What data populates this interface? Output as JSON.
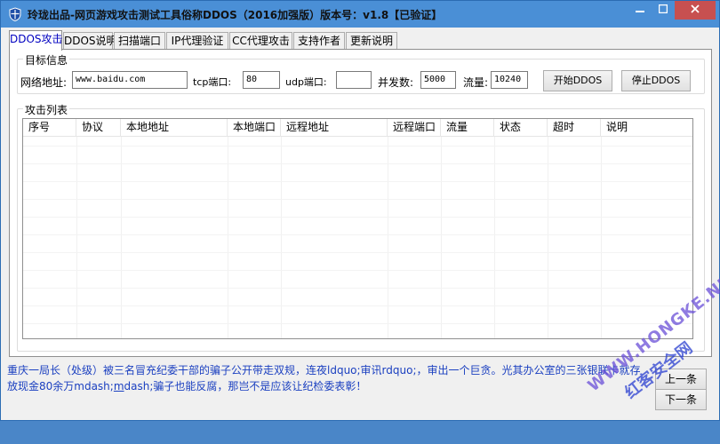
{
  "window": {
    "title": "玲珑出品-网页游戏攻击测试工具俗称DDOS（2016加强版）版本号：v1.8【已验证】",
    "accent": "#4a8fd6"
  },
  "tabs": [
    {
      "label": "DDOS攻击",
      "active": true
    },
    {
      "label": "DDOS说明"
    },
    {
      "label": "扫描端口"
    },
    {
      "label": "IP代理验证"
    },
    {
      "label": "CC代理攻击"
    },
    {
      "label": "支持作者"
    },
    {
      "label": "更新说明"
    }
  ],
  "target": {
    "group_label": "目标信息",
    "url_label": "网络地址:",
    "url_value": "www.baidu.com",
    "tcp_label": "tcp端口:",
    "tcp_value": "80",
    "udp_label": "udp端口:",
    "udp_value": "",
    "concurrency_label": "并发数:",
    "concurrency_value": "5000",
    "traffic_label": "流量:",
    "traffic_value": "10240",
    "start_button": "开始DDOS",
    "stop_button": "停止DDOS"
  },
  "attack_list": {
    "group_label": "攻击列表",
    "columns": [
      "序号",
      "协议",
      "本地地址",
      "本地端口",
      "远程地址",
      "远程端口",
      "流量",
      "状态",
      "超时",
      "说明"
    ]
  },
  "footer": {
    "line1": "重庆一局长（处级）被三名冒充纪委干部的骗子公开带走双规，连夜ldquo;审讯rdquo;，审出一个巨贪。光其办公室的三张银联卡就存",
    "line2_a": "放现金80余万mdash;",
    "line2_b": "m",
    "line2_c": "dash;骗子也能反腐，那岂不是应该让纪检委表彰！",
    "prev_button": "上一条",
    "next_button": "下一条"
  },
  "watermark": {
    "line1": "WWW.HONGKE.NET",
    "line2": "红客安全网"
  }
}
